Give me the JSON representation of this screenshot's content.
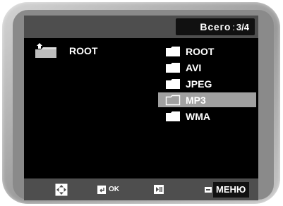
{
  "header": {
    "total_label": "Всего",
    "separator": ":",
    "page_counter": "3/4"
  },
  "current_folder": {
    "label": "ROOT",
    "icon": "folder-up-icon"
  },
  "file_list": {
    "items": [
      {
        "label": "ROOT",
        "icon": "folder-icon",
        "selected": false
      },
      {
        "label": "AVI",
        "icon": "folder-icon",
        "selected": false
      },
      {
        "label": "JPEG",
        "icon": "folder-icon",
        "selected": false
      },
      {
        "label": "MP3",
        "icon": "folder-icon",
        "selected": true
      },
      {
        "label": "WMA",
        "icon": "folder-icon",
        "selected": false
      }
    ]
  },
  "footer": {
    "navigate_icon": "dpad-arrows-icon",
    "ok_icon": "enter-key-icon",
    "ok_label": "OK",
    "play_pause_icon": "play-pause-icon",
    "menu_icon": "menu-key-icon",
    "menu_label": "МЕНЮ"
  },
  "colors": {
    "screen_bg": "#000000",
    "bar_bg": "#4e4e4e",
    "selection": "#a0a0a0",
    "text": "#ffffff"
  }
}
